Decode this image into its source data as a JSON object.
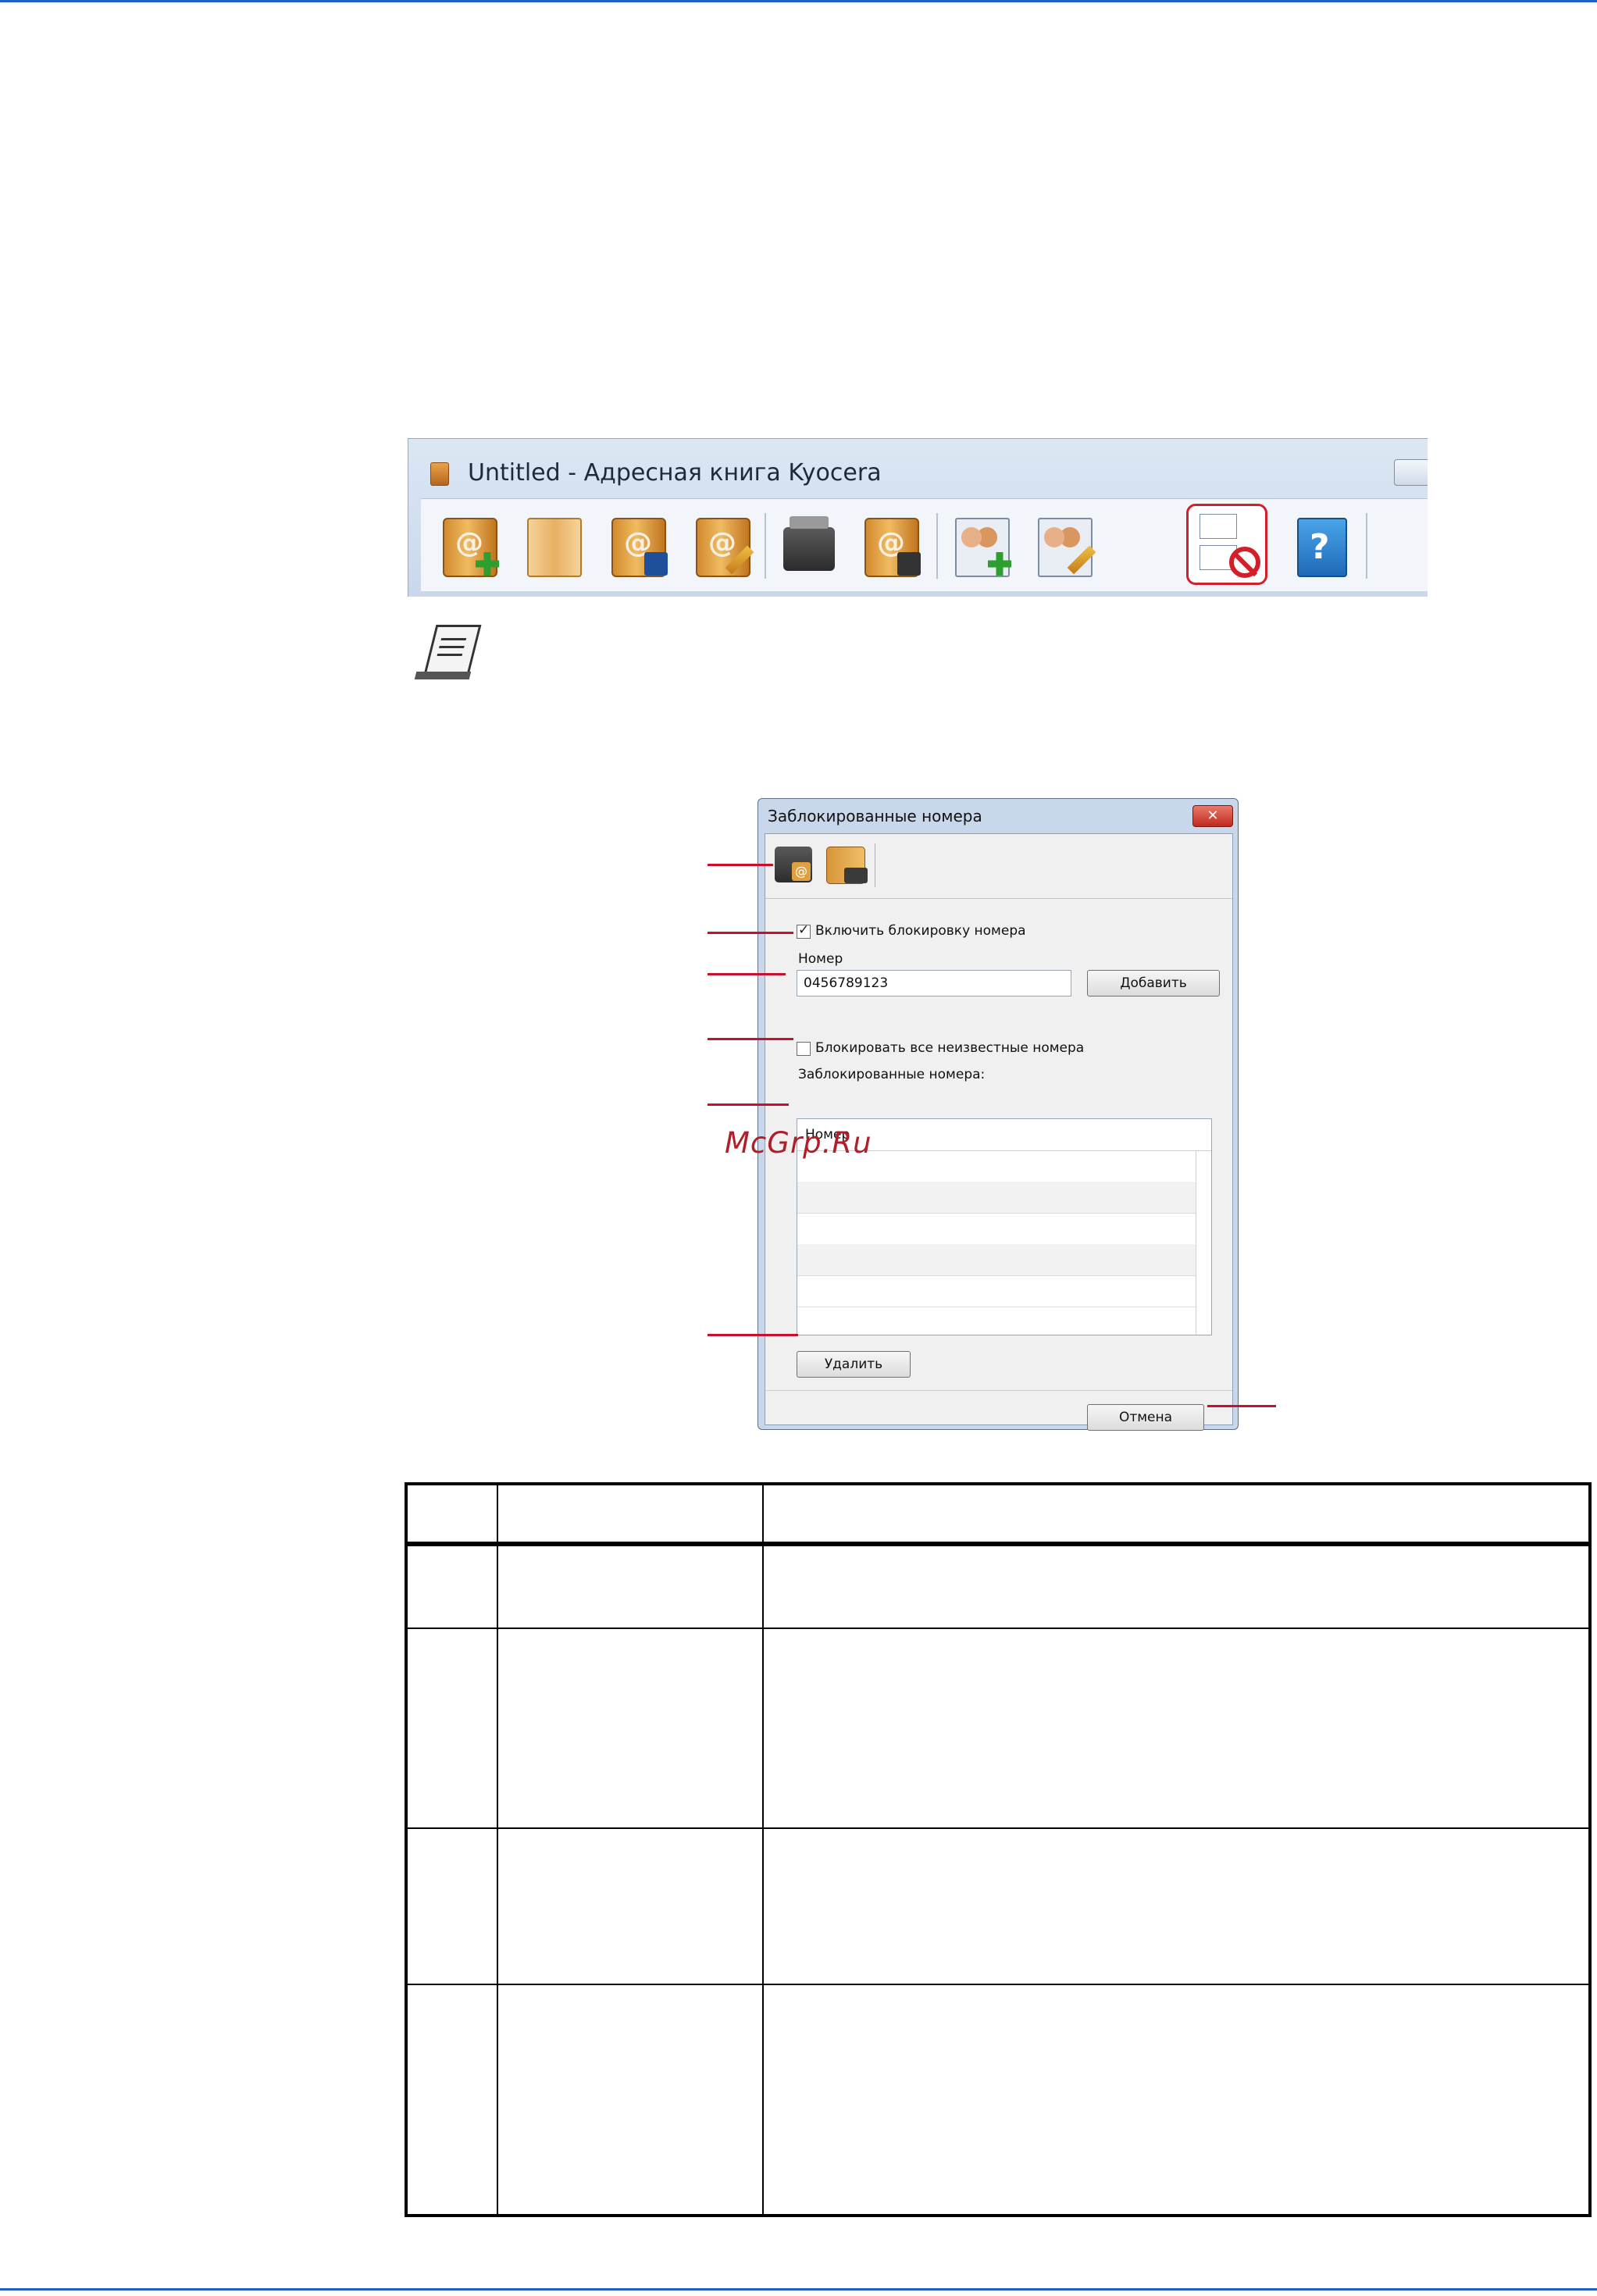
{
  "app_window": {
    "title": "Untitled - Адресная книга Kyocera",
    "toolbar_icons": [
      "address-book-new-contact-icon",
      "address-book-open-icon",
      "address-book-save-icon",
      "address-book-edit-icon",
      "device-address-book-icon",
      "device-import-icon",
      "add-contact-icon",
      "edit-contact-icon",
      "delete-contact-icon",
      "blocked-numbers-icon",
      "help-icon"
    ],
    "highlight_color": "#d21f2a"
  },
  "dialog": {
    "title": "Заблокированные номера",
    "close_label": "✕",
    "enable_blocking_label": "Включить блокировку номера",
    "enable_blocking_checked": true,
    "number_label": "Номер",
    "number_value": "0456789123",
    "add_button": "Добавить",
    "block_unknown_label": "Блокировать все неизвестные номера",
    "block_unknown_checked": false,
    "blocked_list_label": "Заблокированные номера:",
    "list_header": "Номер",
    "list_rows": [
      "",
      "",
      "",
      "",
      ""
    ],
    "delete_button": "Удалить",
    "cancel_button": "Отмена"
  },
  "watermark": "McGrp.Ru",
  "colors": {
    "page_rule": "#1f5fc6",
    "callout": "#c8102e"
  }
}
